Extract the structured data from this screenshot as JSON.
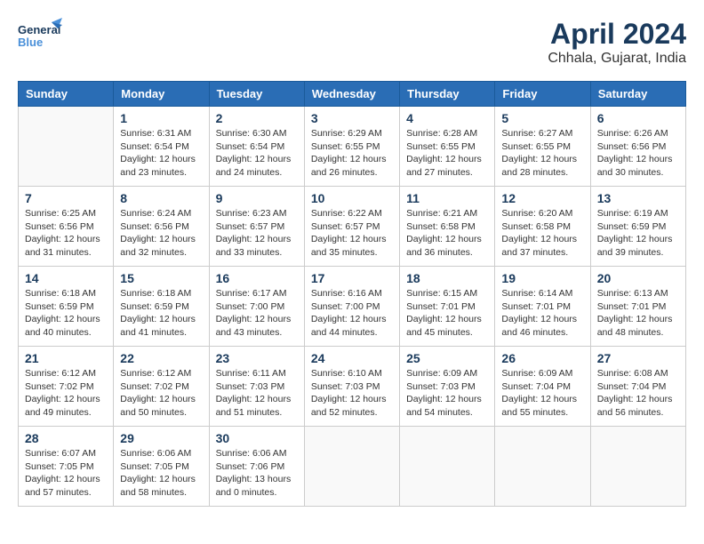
{
  "header": {
    "logo_general": "General",
    "logo_blue": "Blue",
    "month_year": "April 2024",
    "location": "Chhala, Gujarat, India"
  },
  "weekdays": [
    "Sunday",
    "Monday",
    "Tuesday",
    "Wednesday",
    "Thursday",
    "Friday",
    "Saturday"
  ],
  "weeks": [
    [
      {
        "day": "",
        "sunrise": "",
        "sunset": "",
        "daylight": ""
      },
      {
        "day": "1",
        "sunrise": "Sunrise: 6:31 AM",
        "sunset": "Sunset: 6:54 PM",
        "daylight": "Daylight: 12 hours and 23 minutes."
      },
      {
        "day": "2",
        "sunrise": "Sunrise: 6:30 AM",
        "sunset": "Sunset: 6:54 PM",
        "daylight": "Daylight: 12 hours and 24 minutes."
      },
      {
        "day": "3",
        "sunrise": "Sunrise: 6:29 AM",
        "sunset": "Sunset: 6:55 PM",
        "daylight": "Daylight: 12 hours and 26 minutes."
      },
      {
        "day": "4",
        "sunrise": "Sunrise: 6:28 AM",
        "sunset": "Sunset: 6:55 PM",
        "daylight": "Daylight: 12 hours and 27 minutes."
      },
      {
        "day": "5",
        "sunrise": "Sunrise: 6:27 AM",
        "sunset": "Sunset: 6:55 PM",
        "daylight": "Daylight: 12 hours and 28 minutes."
      },
      {
        "day": "6",
        "sunrise": "Sunrise: 6:26 AM",
        "sunset": "Sunset: 6:56 PM",
        "daylight": "Daylight: 12 hours and 30 minutes."
      }
    ],
    [
      {
        "day": "7",
        "sunrise": "Sunrise: 6:25 AM",
        "sunset": "Sunset: 6:56 PM",
        "daylight": "Daylight: 12 hours and 31 minutes."
      },
      {
        "day": "8",
        "sunrise": "Sunrise: 6:24 AM",
        "sunset": "Sunset: 6:56 PM",
        "daylight": "Daylight: 12 hours and 32 minutes."
      },
      {
        "day": "9",
        "sunrise": "Sunrise: 6:23 AM",
        "sunset": "Sunset: 6:57 PM",
        "daylight": "Daylight: 12 hours and 33 minutes."
      },
      {
        "day": "10",
        "sunrise": "Sunrise: 6:22 AM",
        "sunset": "Sunset: 6:57 PM",
        "daylight": "Daylight: 12 hours and 35 minutes."
      },
      {
        "day": "11",
        "sunrise": "Sunrise: 6:21 AM",
        "sunset": "Sunset: 6:58 PM",
        "daylight": "Daylight: 12 hours and 36 minutes."
      },
      {
        "day": "12",
        "sunrise": "Sunrise: 6:20 AM",
        "sunset": "Sunset: 6:58 PM",
        "daylight": "Daylight: 12 hours and 37 minutes."
      },
      {
        "day": "13",
        "sunrise": "Sunrise: 6:19 AM",
        "sunset": "Sunset: 6:59 PM",
        "daylight": "Daylight: 12 hours and 39 minutes."
      }
    ],
    [
      {
        "day": "14",
        "sunrise": "Sunrise: 6:18 AM",
        "sunset": "Sunset: 6:59 PM",
        "daylight": "Daylight: 12 hours and 40 minutes."
      },
      {
        "day": "15",
        "sunrise": "Sunrise: 6:18 AM",
        "sunset": "Sunset: 6:59 PM",
        "daylight": "Daylight: 12 hours and 41 minutes."
      },
      {
        "day": "16",
        "sunrise": "Sunrise: 6:17 AM",
        "sunset": "Sunset: 7:00 PM",
        "daylight": "Daylight: 12 hours and 43 minutes."
      },
      {
        "day": "17",
        "sunrise": "Sunrise: 6:16 AM",
        "sunset": "Sunset: 7:00 PM",
        "daylight": "Daylight: 12 hours and 44 minutes."
      },
      {
        "day": "18",
        "sunrise": "Sunrise: 6:15 AM",
        "sunset": "Sunset: 7:01 PM",
        "daylight": "Daylight: 12 hours and 45 minutes."
      },
      {
        "day": "19",
        "sunrise": "Sunrise: 6:14 AM",
        "sunset": "Sunset: 7:01 PM",
        "daylight": "Daylight: 12 hours and 46 minutes."
      },
      {
        "day": "20",
        "sunrise": "Sunrise: 6:13 AM",
        "sunset": "Sunset: 7:01 PM",
        "daylight": "Daylight: 12 hours and 48 minutes."
      }
    ],
    [
      {
        "day": "21",
        "sunrise": "Sunrise: 6:12 AM",
        "sunset": "Sunset: 7:02 PM",
        "daylight": "Daylight: 12 hours and 49 minutes."
      },
      {
        "day": "22",
        "sunrise": "Sunrise: 6:12 AM",
        "sunset": "Sunset: 7:02 PM",
        "daylight": "Daylight: 12 hours and 50 minutes."
      },
      {
        "day": "23",
        "sunrise": "Sunrise: 6:11 AM",
        "sunset": "Sunset: 7:03 PM",
        "daylight": "Daylight: 12 hours and 51 minutes."
      },
      {
        "day": "24",
        "sunrise": "Sunrise: 6:10 AM",
        "sunset": "Sunset: 7:03 PM",
        "daylight": "Daylight: 12 hours and 52 minutes."
      },
      {
        "day": "25",
        "sunrise": "Sunrise: 6:09 AM",
        "sunset": "Sunset: 7:03 PM",
        "daylight": "Daylight: 12 hours and 54 minutes."
      },
      {
        "day": "26",
        "sunrise": "Sunrise: 6:09 AM",
        "sunset": "Sunset: 7:04 PM",
        "daylight": "Daylight: 12 hours and 55 minutes."
      },
      {
        "day": "27",
        "sunrise": "Sunrise: 6:08 AM",
        "sunset": "Sunset: 7:04 PM",
        "daylight": "Daylight: 12 hours and 56 minutes."
      }
    ],
    [
      {
        "day": "28",
        "sunrise": "Sunrise: 6:07 AM",
        "sunset": "Sunset: 7:05 PM",
        "daylight": "Daylight: 12 hours and 57 minutes."
      },
      {
        "day": "29",
        "sunrise": "Sunrise: 6:06 AM",
        "sunset": "Sunset: 7:05 PM",
        "daylight": "Daylight: 12 hours and 58 minutes."
      },
      {
        "day": "30",
        "sunrise": "Sunrise: 6:06 AM",
        "sunset": "Sunset: 7:06 PM",
        "daylight": "Daylight: 13 hours and 0 minutes."
      },
      {
        "day": "",
        "sunrise": "",
        "sunset": "",
        "daylight": ""
      },
      {
        "day": "",
        "sunrise": "",
        "sunset": "",
        "daylight": ""
      },
      {
        "day": "",
        "sunrise": "",
        "sunset": "",
        "daylight": ""
      },
      {
        "day": "",
        "sunrise": "",
        "sunset": "",
        "daylight": ""
      }
    ]
  ]
}
